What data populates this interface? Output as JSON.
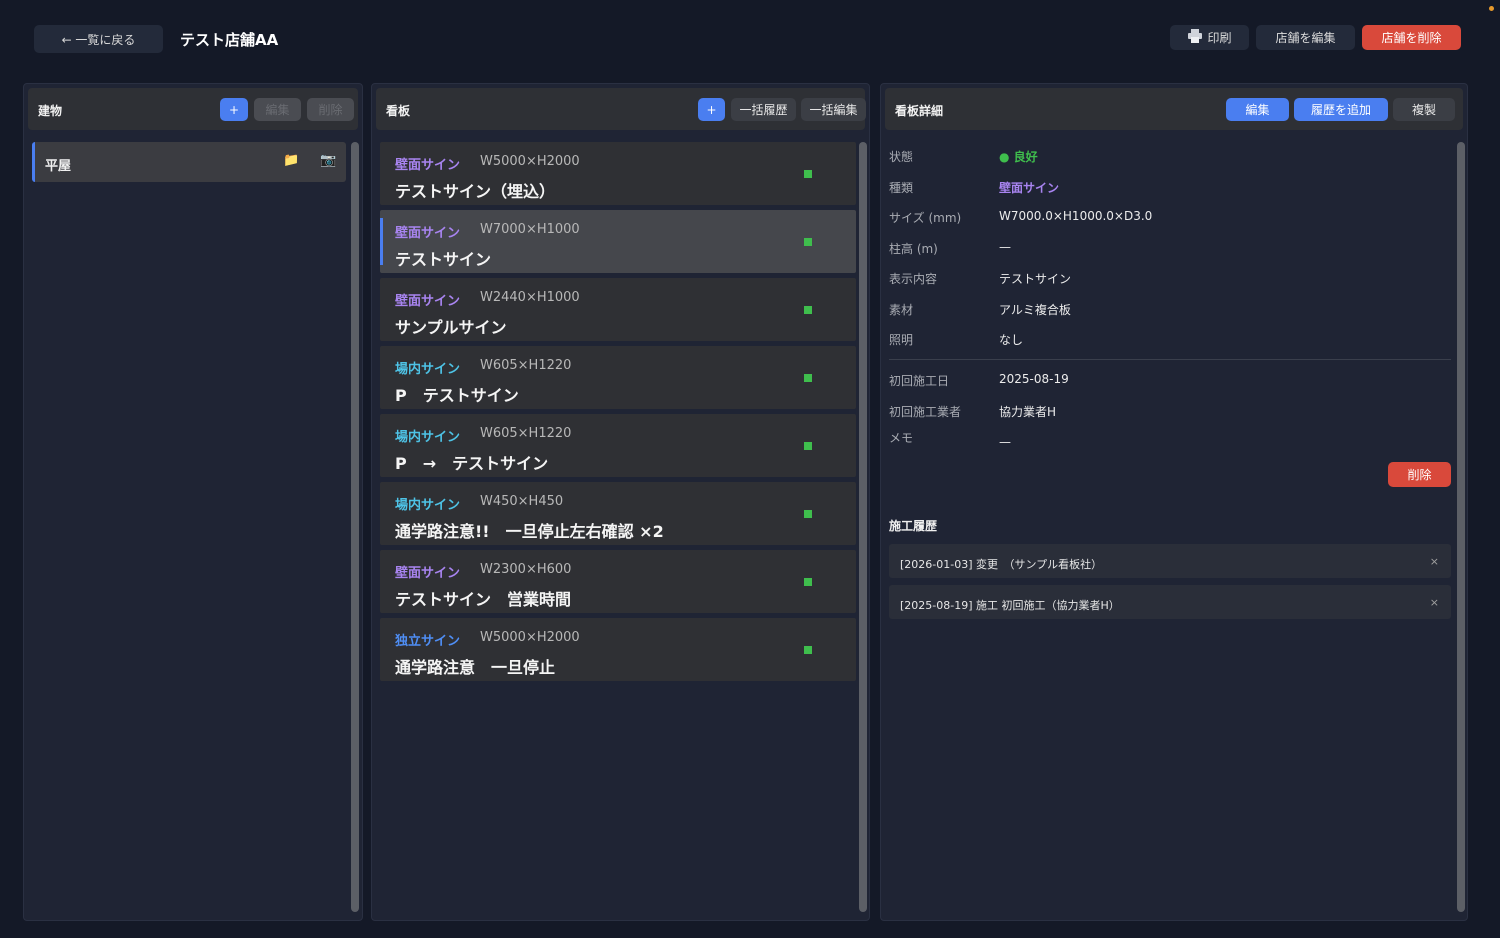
{
  "topbar": {
    "back_label": "← 一覧に戻る",
    "store_title": "テスト店舗AA",
    "print_label": "印刷",
    "edit_store_label": "店舗を編集",
    "delete_store_label": "店舗を削除"
  },
  "buildings_panel": {
    "title": "建物",
    "add_label": "+",
    "edit_label": "編集",
    "delete_label": "削除",
    "items": [
      {
        "name": "平屋",
        "folder_icon": "📁",
        "camera_icon": "📷"
      }
    ]
  },
  "signs_panel": {
    "title": "看板",
    "add_label": "+",
    "bulk_history_label": "一括履歴",
    "bulk_edit_label": "一括編集",
    "items": [
      {
        "type": "壁面サイン",
        "size": "W5000×H2000",
        "name": "テストサイン（埋込）",
        "type_color": "#a884f0"
      },
      {
        "type": "壁面サイン",
        "size": "W7000×H1000",
        "name": "テストサイン",
        "type_color": "#a884f0",
        "selected": true
      },
      {
        "type": "壁面サイン",
        "size": "W2440×H1000",
        "name": "サンプルサイン",
        "type_color": "#a884f0"
      },
      {
        "type": "場内サイン",
        "size": "W605×H1220",
        "name": "P　テストサイン",
        "type_color": "#4ec3e6"
      },
      {
        "type": "場内サイン",
        "size": "W605×H1220",
        "name": "P　→　テストサイン",
        "type_color": "#4ec3e6"
      },
      {
        "type": "場内サイン",
        "size": "W450×H450",
        "name": "通学路注意!!　一旦停止左右確認 ×2",
        "type_color": "#4ec3e6"
      },
      {
        "type": "壁面サイン",
        "size": "W2300×H600",
        "name": "テストサイン　営業時間",
        "type_color": "#a884f0"
      },
      {
        "type": "独立サイン",
        "size": "W5000×H2000",
        "name": "通学路注意　一旦停止",
        "type_color": "#4f8ef5"
      }
    ]
  },
  "detail_panel": {
    "title": "看板詳細",
    "edit_label": "編集",
    "add_history_label": "履歴を追加",
    "duplicate_label": "複製",
    "delete_label": "削除",
    "fields": {
      "status_label": "状態",
      "status_value": "良好",
      "status_color": "#3fbe4d",
      "kind_label": "種類",
      "kind_value": "壁面サイン",
      "kind_color": "#a884f0",
      "size_label": "サイズ (mm)",
      "size_value": "W7000.0×H1000.0×D3.0",
      "pole_label": "柱高 (m)",
      "pole_value": "—",
      "content_label": "表示内容",
      "content_value": "テストサイン",
      "material_label": "素材",
      "material_value": "アルミ複合板",
      "lighting_label": "照明",
      "lighting_value": "なし",
      "first_date_label": "初回施工日",
      "first_date_value": "2025-08-19",
      "first_contractor_label": "初回施工業者",
      "first_contractor_value": "協力業者H",
      "memo_label": "メモ",
      "memo_value": "—"
    },
    "history_title": "施工履歴",
    "history": [
      {
        "text": "[2026-01-03]  変更　（サンプル看板社）",
        "close": "×"
      },
      {
        "text": "[2025-08-19]  施工  初回施工（協力業者H）",
        "close": "×"
      }
    ]
  },
  "colors": {
    "accent": "#4a7ef0",
    "danger": "#d9493b"
  }
}
